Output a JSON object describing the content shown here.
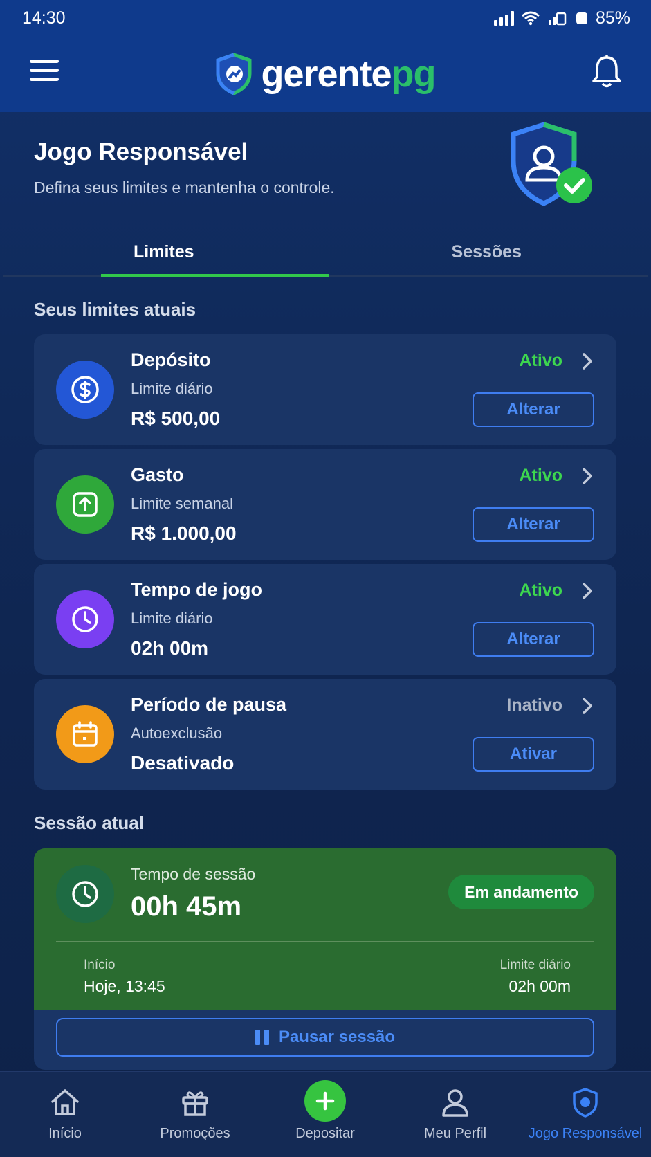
{
  "status_bar": {
    "time": "14:30",
    "battery": "85%"
  },
  "header": {
    "logo_part1": "gerente",
    "logo_part2": "pg"
  },
  "hero": {
    "title": "Jogo Responsável",
    "subtitle": "Defina seus limites e mantenha o controle."
  },
  "tabs": [
    {
      "label": "Limites",
      "active": true
    },
    {
      "label": "Sessões",
      "active": false
    }
  ],
  "limits_section": {
    "title": "Seus limites atuais",
    "items": [
      {
        "title": "Depósito",
        "subtitle": "Limite diário",
        "value": "R$ 500,00",
        "status": "Ativo",
        "status_color": "#3dd64f",
        "button": "Alterar",
        "icon": "dollar-icon",
        "icon_color": "#2357d6"
      },
      {
        "title": "Gasto",
        "subtitle": "Limite semanal",
        "value": "R$ 1.000,00",
        "status": "Ativo",
        "status_color": "#3dd64f",
        "button": "Alterar",
        "icon": "upload-icon",
        "icon_color": "#2fa83a"
      },
      {
        "title": "Tempo de jogo",
        "subtitle": "Limite diário",
        "value": "02h 00m",
        "status": "Ativo",
        "status_color": "#3dd64f",
        "button": "Alterar",
        "icon": "clock-icon",
        "icon_color": "#7a3ff2"
      },
      {
        "title": "Período de pausa",
        "subtitle": "Autoexclusão",
        "value": "Desativado",
        "status": "Inativo",
        "status_color": "#aab4c6",
        "button": "Ativar",
        "icon": "calendar-icon",
        "icon_color": "#f29a18"
      }
    ]
  },
  "session_section": {
    "title": "Sessão atual",
    "label": "Tempo de sessão",
    "time": "00h 45m",
    "badge": "Em andamento",
    "start_label": "Início",
    "start_value": "Hoje, 13:45",
    "limit_label": "Limite diário",
    "limit_value": "02h 00m",
    "pause_button": "Pausar sessão"
  },
  "bottom_nav": [
    {
      "label": "Início",
      "icon": "home-icon",
      "active": false
    },
    {
      "label": "Promoções",
      "icon": "gift-icon",
      "active": false
    },
    {
      "label": "Depositar",
      "icon": "plus-icon",
      "active": false
    },
    {
      "label": "Meu Perfil",
      "icon": "user-icon",
      "active": false
    },
    {
      "label": "Jogo Responsável",
      "icon": "shield-icon",
      "active": true
    }
  ],
  "colors": {
    "accent_blue": "#3f7df0",
    "accent_green": "#32c84b",
    "header_bg": "#0f3a8c",
    "card_bg": "#1a3566",
    "session_green": "#2a6c30"
  }
}
